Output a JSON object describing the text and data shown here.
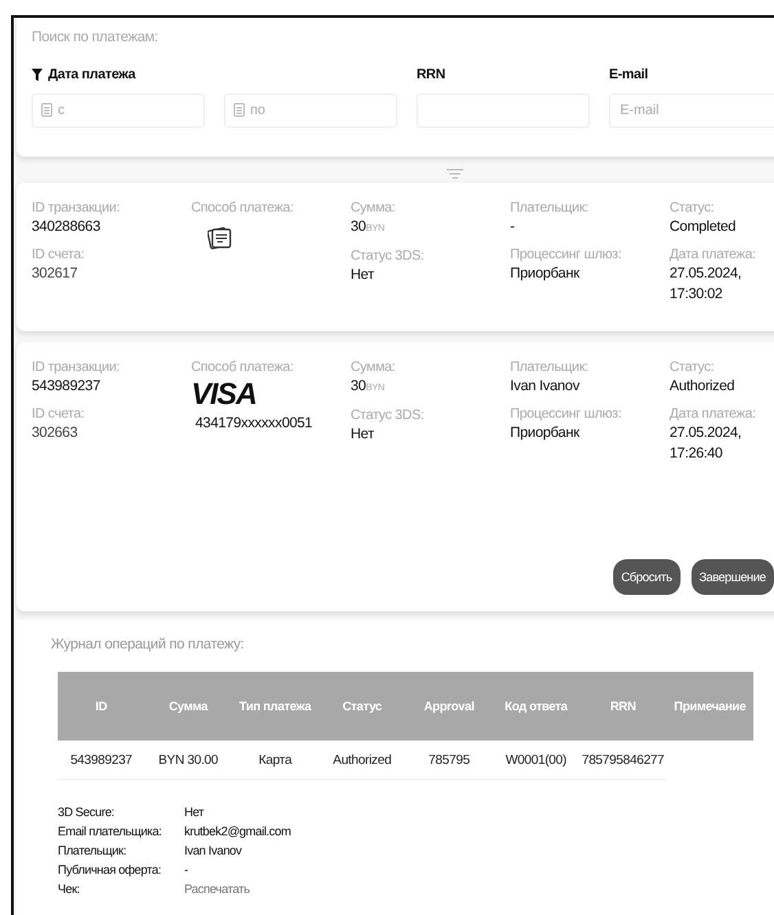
{
  "search": {
    "title": "Поиск по платежам:",
    "groups": [
      {
        "label": "Дата платежа",
        "filterable": true,
        "fields": [
          {
            "kind": "date",
            "placeholder": "с"
          },
          {
            "kind": "date",
            "placeholder": "по"
          }
        ]
      },
      {
        "label": "RRN",
        "filterable": false,
        "fields": [
          {
            "kind": "text"
          }
        ]
      },
      {
        "label": "E-mail",
        "filterable": false,
        "fields": [
          {
            "kind": "text",
            "placeholder": "E-mail"
          }
        ]
      }
    ]
  },
  "transactions": [
    {
      "transaction_id": {
        "label": "ID транзакции:",
        "value": "340288663"
      },
      "account_id": {
        "label": "ID счета:",
        "value": "302617"
      },
      "method": {
        "label": "Способ платежа:",
        "kind": "card-icon"
      },
      "amount": {
        "label": "Сумма:",
        "value": "30",
        "unit": "BYN"
      },
      "status_3ds": {
        "label": "Статус 3DS:",
        "value": "Нет"
      },
      "payer": {
        "label": "Плательщик:",
        "value": "-"
      },
      "gateway": {
        "label": "Процессинг шлюз:",
        "value": "Приорбанк"
      },
      "status": {
        "label": "Статус:",
        "value": "Completed"
      },
      "date": {
        "label": "Дата платежа:",
        "value": "27.05.2024, 17:30:02"
      }
    },
    {
      "transaction_id": {
        "label": "ID транзакции:",
        "value": "543989237"
      },
      "account_id": {
        "label": "ID счета:",
        "value": "302663"
      },
      "method": {
        "label": "Способ платежа:",
        "kind": "visa",
        "logo": "VISA",
        "card_number": "434179xxxxxx0051"
      },
      "amount": {
        "label": "Сумма:",
        "value": "30",
        "unit": "BYN"
      },
      "status_3ds": {
        "label": "Статус 3DS:",
        "value": "Нет"
      },
      "payer": {
        "label": "Плательщик:",
        "value": "Ivan Ivanov"
      },
      "gateway": {
        "label": "Процессинг шлюз:",
        "value": "Приорбанк"
      },
      "status": {
        "label": "Статус:",
        "value": "Authorized"
      },
      "date": {
        "label": "Дата платежа:",
        "value": "27.05.2024, 17:26:40"
      },
      "buttons": [
        "Сбросить",
        "Завершение"
      ]
    }
  ],
  "journal": {
    "title": "Журнал операций по платежу:",
    "columns": [
      "ID",
      "Сумма",
      "Тип платежа",
      "Статус",
      "Approval",
      "Код ответа",
      "RRN",
      "Примечание"
    ],
    "rows": [
      [
        "543989237",
        "BYN 30.00",
        "Карта",
        "Authorized",
        "785795",
        "W0001(00)",
        "785795846277"
      ]
    ],
    "details": [
      {
        "label": "3D Secure:",
        "value": "Нет",
        "kind": "text"
      },
      {
        "label": "Email плательщика:",
        "value": "krutbek2@gmail.com",
        "kind": "text"
      },
      {
        "label": "Плательщик:",
        "value": "Ivan Ivanov",
        "kind": "text"
      },
      {
        "label": "Публичная оферта:",
        "value": "-",
        "kind": "text"
      },
      {
        "label": "Чек:",
        "value": "Распечатать",
        "kind": "link"
      }
    ]
  }
}
